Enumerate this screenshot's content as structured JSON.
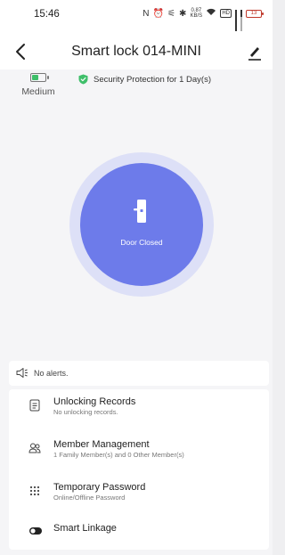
{
  "status_bar": {
    "time": "15:46",
    "net_speed_top": "0.87",
    "net_speed_bottom": "KB/S",
    "volte": "HD",
    "battery": "13"
  },
  "header": {
    "title": "Smart lock 014-MINI",
    "back_icon": "chevron-left-icon",
    "edit_icon": "pencil-icon"
  },
  "device": {
    "battery_label": "Medium",
    "battery_level": 0.5,
    "security_text": "Security Protection for 1 Day(s)",
    "door_status": "Door Closed"
  },
  "alerts": {
    "text": "No alerts."
  },
  "menu": [
    {
      "title": "Unlocking Records",
      "subtitle": "No unlocking records.",
      "icon": "document-icon"
    },
    {
      "title": "Member Management",
      "subtitle": "1 Family Member(s) and 0 Other Member(s)",
      "icon": "members-icon"
    },
    {
      "title": "Temporary Password",
      "subtitle": "Online/Offline Password",
      "icon": "keypad-icon"
    },
    {
      "title": "Smart Linkage",
      "subtitle": "",
      "icon": "toggle-icon"
    }
  ],
  "colors": {
    "accent": "#6d7bea",
    "ring": "#dde0f7",
    "security_green": "#3fbf6a",
    "background": "#f5f5f7"
  }
}
